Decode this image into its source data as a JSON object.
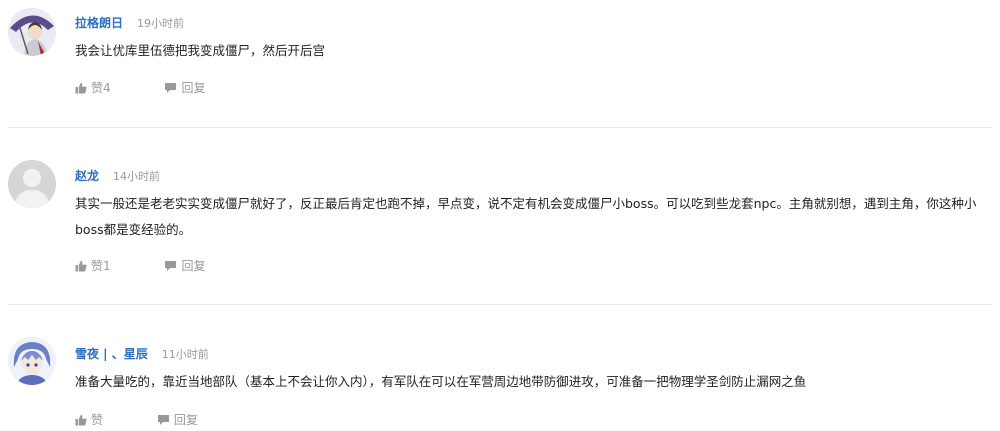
{
  "comments": [
    {
      "user": "拉格朗日",
      "time": "19小时前",
      "text": "我会让优库里伍德把我变成僵尸，然后开后宫",
      "like_label": "赞4",
      "reply_label": "回复"
    },
    {
      "user": "赵龙",
      "time": "14小时前",
      "text": "其实一般还是老老实实变成僵尸就好了，反正最后肯定也跑不掉，早点变，说不定有机会变成僵尸小boss。可以吃到些龙套npc。主角就别想，遇到主角，你这种小boss都是变经验的。",
      "like_label": "赞1",
      "reply_label": "回复"
    },
    {
      "user": "雪夜 | 、星辰",
      "time": "11小时前",
      "text": "准备大量吃的，靠近当地部队（基本上不会让你入内），有军队在可以在军营周边地带防御进攻，可准备一把物理学圣剑防止漏网之鱼",
      "like_label": "赞",
      "reply_label": "回复"
    }
  ],
  "colors": {
    "username": "#2b6fc4",
    "meta": "#999999",
    "text": "#222222",
    "divider": "#e8e8e8"
  },
  "icons": {
    "like": "thumbs-up-icon",
    "reply": "speech-bubble-icon"
  }
}
